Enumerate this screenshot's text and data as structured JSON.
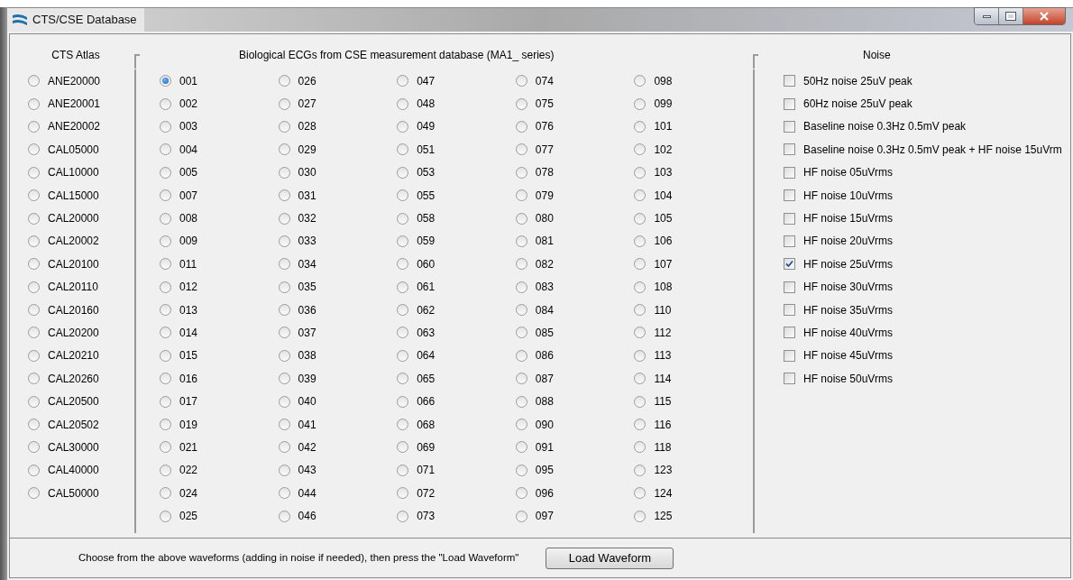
{
  "window": {
    "title": "CTS/CSE Database"
  },
  "atlas": {
    "title": "CTS Atlas",
    "items": [
      {
        "label": "ANE20000",
        "selected": false
      },
      {
        "label": "ANE20001",
        "selected": false
      },
      {
        "label": "ANE20002",
        "selected": false
      },
      {
        "label": "CAL05000",
        "selected": false
      },
      {
        "label": "CAL10000",
        "selected": false
      },
      {
        "label": "CAL15000",
        "selected": false
      },
      {
        "label": "CAL20000",
        "selected": false
      },
      {
        "label": "CAL20002",
        "selected": false
      },
      {
        "label": "CAL20100",
        "selected": false
      },
      {
        "label": "CAL20110",
        "selected": false
      },
      {
        "label": "CAL20160",
        "selected": false
      },
      {
        "label": "CAL20200",
        "selected": false
      },
      {
        "label": "CAL20210",
        "selected": false
      },
      {
        "label": "CAL20260",
        "selected": false
      },
      {
        "label": "CAL20500",
        "selected": false
      },
      {
        "label": "CAL20502",
        "selected": false
      },
      {
        "label": "CAL30000",
        "selected": false
      },
      {
        "label": "CAL40000",
        "selected": false
      },
      {
        "label": "CAL50000",
        "selected": false
      }
    ]
  },
  "biological": {
    "title": "Biological ECGs from CSE measurement database (MA1_ series)",
    "columns": [
      [
        {
          "label": "001",
          "selected": true
        },
        {
          "label": "002",
          "selected": false
        },
        {
          "label": "003",
          "selected": false
        },
        {
          "label": "004",
          "selected": false
        },
        {
          "label": "005",
          "selected": false
        },
        {
          "label": "007",
          "selected": false
        },
        {
          "label": "008",
          "selected": false
        },
        {
          "label": "009",
          "selected": false
        },
        {
          "label": "011",
          "selected": false
        },
        {
          "label": "012",
          "selected": false
        },
        {
          "label": "013",
          "selected": false
        },
        {
          "label": "014",
          "selected": false
        },
        {
          "label": "015",
          "selected": false
        },
        {
          "label": "016",
          "selected": false
        },
        {
          "label": "017",
          "selected": false
        },
        {
          "label": "019",
          "selected": false
        },
        {
          "label": "021",
          "selected": false
        },
        {
          "label": "022",
          "selected": false
        },
        {
          "label": "024",
          "selected": false
        },
        {
          "label": "025",
          "selected": false
        }
      ],
      [
        {
          "label": "026",
          "selected": false
        },
        {
          "label": "027",
          "selected": false
        },
        {
          "label": "028",
          "selected": false
        },
        {
          "label": "029",
          "selected": false
        },
        {
          "label": "030",
          "selected": false
        },
        {
          "label": "031",
          "selected": false
        },
        {
          "label": "032",
          "selected": false
        },
        {
          "label": "033",
          "selected": false
        },
        {
          "label": "034",
          "selected": false
        },
        {
          "label": "035",
          "selected": false
        },
        {
          "label": "036",
          "selected": false
        },
        {
          "label": "037",
          "selected": false
        },
        {
          "label": "038",
          "selected": false
        },
        {
          "label": "039",
          "selected": false
        },
        {
          "label": "040",
          "selected": false
        },
        {
          "label": "041",
          "selected": false
        },
        {
          "label": "042",
          "selected": false
        },
        {
          "label": "043",
          "selected": false
        },
        {
          "label": "044",
          "selected": false
        },
        {
          "label": "046",
          "selected": false
        }
      ],
      [
        {
          "label": "047",
          "selected": false
        },
        {
          "label": "048",
          "selected": false
        },
        {
          "label": "049",
          "selected": false
        },
        {
          "label": "051",
          "selected": false
        },
        {
          "label": "053",
          "selected": false
        },
        {
          "label": "055",
          "selected": false
        },
        {
          "label": "058",
          "selected": false
        },
        {
          "label": "059",
          "selected": false
        },
        {
          "label": "060",
          "selected": false
        },
        {
          "label": "061",
          "selected": false
        },
        {
          "label": "062",
          "selected": false
        },
        {
          "label": "063",
          "selected": false
        },
        {
          "label": "064",
          "selected": false
        },
        {
          "label": "065",
          "selected": false
        },
        {
          "label": "066",
          "selected": false
        },
        {
          "label": "068",
          "selected": false
        },
        {
          "label": "069",
          "selected": false
        },
        {
          "label": "071",
          "selected": false
        },
        {
          "label": "072",
          "selected": false
        },
        {
          "label": "073",
          "selected": false
        }
      ],
      [
        {
          "label": "074",
          "selected": false
        },
        {
          "label": "075",
          "selected": false
        },
        {
          "label": "076",
          "selected": false
        },
        {
          "label": "077",
          "selected": false
        },
        {
          "label": "078",
          "selected": false
        },
        {
          "label": "079",
          "selected": false
        },
        {
          "label": "080",
          "selected": false
        },
        {
          "label": "081",
          "selected": false
        },
        {
          "label": "082",
          "selected": false
        },
        {
          "label": "083",
          "selected": false
        },
        {
          "label": "084",
          "selected": false
        },
        {
          "label": "085",
          "selected": false
        },
        {
          "label": "086",
          "selected": false
        },
        {
          "label": "087",
          "selected": false
        },
        {
          "label": "088",
          "selected": false
        },
        {
          "label": "090",
          "selected": false
        },
        {
          "label": "091",
          "selected": false
        },
        {
          "label": "095",
          "selected": false
        },
        {
          "label": "096",
          "selected": false
        },
        {
          "label": "097",
          "selected": false
        }
      ],
      [
        {
          "label": "098",
          "selected": false
        },
        {
          "label": "099",
          "selected": false
        },
        {
          "label": "101",
          "selected": false
        },
        {
          "label": "102",
          "selected": false
        },
        {
          "label": "103",
          "selected": false
        },
        {
          "label": "104",
          "selected": false
        },
        {
          "label": "105",
          "selected": false
        },
        {
          "label": "106",
          "selected": false
        },
        {
          "label": "107",
          "selected": false
        },
        {
          "label": "108",
          "selected": false
        },
        {
          "label": "110",
          "selected": false
        },
        {
          "label": "112",
          "selected": false
        },
        {
          "label": "113",
          "selected": false
        },
        {
          "label": "114",
          "selected": false
        },
        {
          "label": "115",
          "selected": false
        },
        {
          "label": "116",
          "selected": false
        },
        {
          "label": "118",
          "selected": false
        },
        {
          "label": "123",
          "selected": false
        },
        {
          "label": "124",
          "selected": false
        },
        {
          "label": "125",
          "selected": false
        }
      ]
    ]
  },
  "noise": {
    "title": "Noise",
    "items": [
      {
        "label": "50Hz noise 25uV peak",
        "checked": false
      },
      {
        "label": "60Hz noise 25uV peak",
        "checked": false
      },
      {
        "label": "Baseline noise 0.3Hz 0.5mV peak",
        "checked": false
      },
      {
        "label": "Baseline noise 0.3Hz 0.5mV peak + HF noise 15uVrm",
        "checked": false
      },
      {
        "label": "HF noise 05uVrms",
        "checked": false
      },
      {
        "label": "HF noise 10uVrms",
        "checked": false
      },
      {
        "label": "HF noise 15uVrms",
        "checked": false
      },
      {
        "label": "HF noise 20uVrms",
        "checked": false
      },
      {
        "label": "HF noise 25uVrms",
        "checked": true
      },
      {
        "label": "HF noise 30uVrms",
        "checked": false
      },
      {
        "label": "HF noise 35uVrms",
        "checked": false
      },
      {
        "label": "HF noise 40uVrms",
        "checked": false
      },
      {
        "label": "HF noise 45uVrms",
        "checked": false
      },
      {
        "label": "HF noise 50uVrms",
        "checked": false
      }
    ]
  },
  "footer": {
    "instruction": "Choose from the above waveforms (adding in noise if needed), then press the \"Load Waveform\"",
    "button": "Load Waveform"
  }
}
